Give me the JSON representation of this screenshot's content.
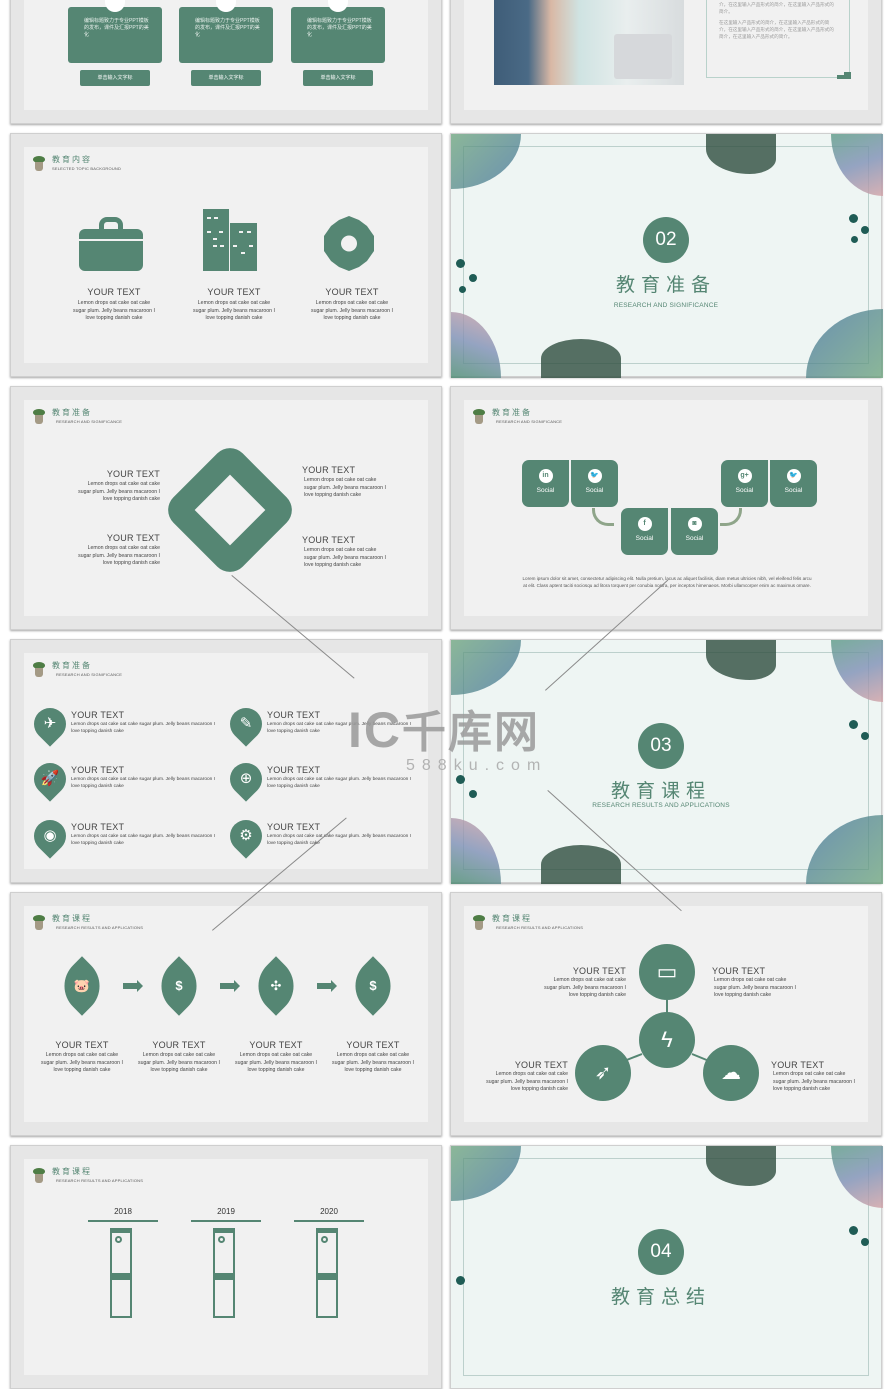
{
  "slides": {
    "s1": {
      "cards": [
        {
          "text": "编辑标题致力于专业PPT模板的发布，课件及汇报PPT的美化",
          "button": "单击输入文字标"
        },
        {
          "text": "编辑标题致力于专业PPT模板的发布，课件及汇报PPT的美化",
          "button": "单击输入文字标"
        },
        {
          "text": "编辑标题致力于专业PPT模板的发布，课件及汇报PPT的美化",
          "button": "单击输入文字标"
        }
      ]
    },
    "s2": {
      "paragraph1": "在这里输入产品形式的简介，在这里输入产品形式的简介，在这里输入产品形式的简介，在这里输入产品形式的简介。",
      "paragraph2": "在这里输入产品形式的简介，在这里输入产品形式的简介，在这里输入产品形式的简介，在这里输入产品形式的简介，在这里输入产品形式的简介。"
    },
    "s3": {
      "header": {
        "title": "教育内容",
        "subtitle": "SELECTED TOPIC BACKGROUND"
      },
      "items": [
        {
          "icon": "briefcase-icon",
          "title": "YOUR TEXT",
          "desc": "Lemon drops oat cake oat cake sugar plum. Jelly beans macaroon I love topping danish cake"
        },
        {
          "icon": "buildings-icon",
          "title": "YOUR TEXT",
          "desc": "Lemon drops oat cake oat cake sugar plum. Jelly beans macaroon I love topping danish cake"
        },
        {
          "icon": "gear-icon",
          "title": "YOUR TEXT",
          "desc": "Lemon drops oat cake oat cake sugar plum. Jelly beans macaroon I love topping danish cake"
        }
      ]
    },
    "s4": {
      "number": "02",
      "title": "教育准备",
      "subtitle": "RESEARCH AND SIGNIFICANCE"
    },
    "s5": {
      "header": {
        "title": "教育准备",
        "subtitle": "RESEARCH AND SIGNIFICANCE"
      },
      "items": [
        {
          "title": "YOUR TEXT",
          "desc": "Lemon drops oat cake oat cake sugar plum. Jelly beans macaroon I love topping danish cake"
        },
        {
          "title": "YOUR TEXT",
          "desc": "Lemon drops oat cake oat cake sugar plum. Jelly beans macaroon I love topping danish cake"
        },
        {
          "title": "YOUR TEXT",
          "desc": "Lemon drops oat cake oat cake sugar plum. Jelly beans macaroon I love topping danish cake"
        },
        {
          "title": "YOUR TEXT",
          "desc": "Lemon drops oat cake oat cake sugar plum. Jelly beans macaroon I love topping danish cake"
        }
      ]
    },
    "s6": {
      "header": {
        "title": "教育准备",
        "subtitle": "RESEARCH AND SIGNIFICANCE"
      },
      "tiles": [
        {
          "icon": "linkedin-icon",
          "glyph": "in",
          "label": "Social"
        },
        {
          "icon": "twitter-icon",
          "glyph": "🐦",
          "label": "Social"
        },
        {
          "icon": "facebook-icon",
          "glyph": "f",
          "label": "Social"
        },
        {
          "icon": "instagram-icon",
          "glyph": "◙",
          "label": "Social"
        },
        {
          "icon": "google-plus-icon",
          "glyph": "g+",
          "label": "Social"
        },
        {
          "icon": "twitter-icon",
          "glyph": "🐦",
          "label": "Social"
        }
      ],
      "caption": "Lorem ipsum dolor sit amet, consectetur adipiscing elit. Nulla pretium, lacus ac aliquet facilisis, diam metus ultricies nibh, vel eleifend felis arcu at elit. Class aptent taciti sociosqu ad litora torquent per conubia nostra, per inceptos himenaeos. Morbi ullamcorper enim ac maximus ornare."
    },
    "s7": {
      "header": {
        "title": "教育准备",
        "subtitle": "RESEARCH AND SIGNIFICANCE"
      },
      "items": [
        {
          "icon": "paper-plane-icon",
          "glyph": "✈",
          "title": "YOUR TEXT",
          "desc": "Lemon drops oat cake oat cake sugar plum. Jelly beans macaroon I love topping danish cake"
        },
        {
          "icon": "pencil-icon",
          "glyph": "✎",
          "title": "YOUR TEXT",
          "desc": "Lemon drops oat cake oat cake sugar plum. Jelly beans macaroon I love topping danish cake"
        },
        {
          "icon": "rocket-icon",
          "glyph": "🚀",
          "title": "YOUR TEXT",
          "desc": "Lemon drops oat cake oat cake sugar plum. Jelly beans macaroon I love topping danish cake"
        },
        {
          "icon": "globe-icon",
          "glyph": "⊕",
          "title": "YOUR TEXT",
          "desc": "Lemon drops oat cake oat cake sugar plum. Jelly beans macaroon I love topping danish cake"
        },
        {
          "icon": "location-pin-icon",
          "glyph": "◉",
          "title": "YOUR TEXT",
          "desc": "Lemon drops oat cake oat cake sugar plum. Jelly beans macaroon I love topping danish cake"
        },
        {
          "icon": "gear-icon",
          "glyph": "⚙",
          "title": "YOUR TEXT",
          "desc": "Lemon drops oat cake oat cake sugar plum. Jelly beans macaroon I love topping danish cake"
        }
      ]
    },
    "s8": {
      "number": "03",
      "title": "教育课程",
      "subtitle": "RESEARCH RESULTS AND APPLICATIONS"
    },
    "s9": {
      "header": {
        "title": "教育课程",
        "subtitle": "RESEARCH RESULTS AND APPLICATIONS"
      },
      "steps": [
        {
          "icon": "piggy-bank-icon",
          "glyph": "🐷",
          "title": "YOUR TEXT",
          "desc": "Lemon drops oat cake oat cake sugar plum. Jelly beans macaroon I love topping danish cake"
        },
        {
          "icon": "hand-coin-icon",
          "glyph": "$",
          "title": "YOUR TEXT",
          "desc": "Lemon drops oat cake oat cake sugar plum. Jelly beans macaroon I love topping danish cake"
        },
        {
          "icon": "money-network-icon",
          "glyph": "✣",
          "title": "YOUR TEXT",
          "desc": "Lemon drops oat cake oat cake sugar plum. Jelly beans macaroon I love topping danish cake"
        },
        {
          "icon": "coin-stack-icon",
          "glyph": "$",
          "title": "YOUR TEXT",
          "desc": "Lemon drops oat cake oat cake sugar plum. Jelly beans macaroon I love topping danish cake"
        }
      ]
    },
    "s10": {
      "header": {
        "title": "教育课程",
        "subtitle": "RESEARCH RESULTS AND APPLICATIONS"
      },
      "items": [
        {
          "title": "YOUR TEXT",
          "desc": "Lemon drops oat cake oat cake sugar plum. Jelly beans macaroon I love topping danish cake"
        },
        {
          "title": "YOUR TEXT",
          "desc": "Lemon drops oat cake oat cake sugar plum. Jelly beans macaroon I love topping danish cake"
        },
        {
          "title": "YOUR TEXT",
          "desc": "Lemon drops oat cake oat cake sugar plum. Jelly beans macaroon I love topping danish cake"
        },
        {
          "title": "YOUR TEXT",
          "desc": "Lemon drops oat cake oat cake sugar plum. Jelly beans macaroon I love topping danish cake"
        }
      ]
    },
    "s11": {
      "header": {
        "title": "教育课程",
        "subtitle": "RESEARCH RESULTS AND APPLICATIONS"
      },
      "years": [
        "2018",
        "2019",
        "2020"
      ]
    },
    "s12": {
      "number": "04",
      "title": "教育总结"
    }
  },
  "watermark": {
    "brand": "千库网",
    "domain": "588ku.com"
  },
  "colors": {
    "accent": "#558673",
    "slide_bg": "#f1f1f1",
    "frame": "#e6e6e6",
    "cover_bg": "#eef5f3"
  }
}
